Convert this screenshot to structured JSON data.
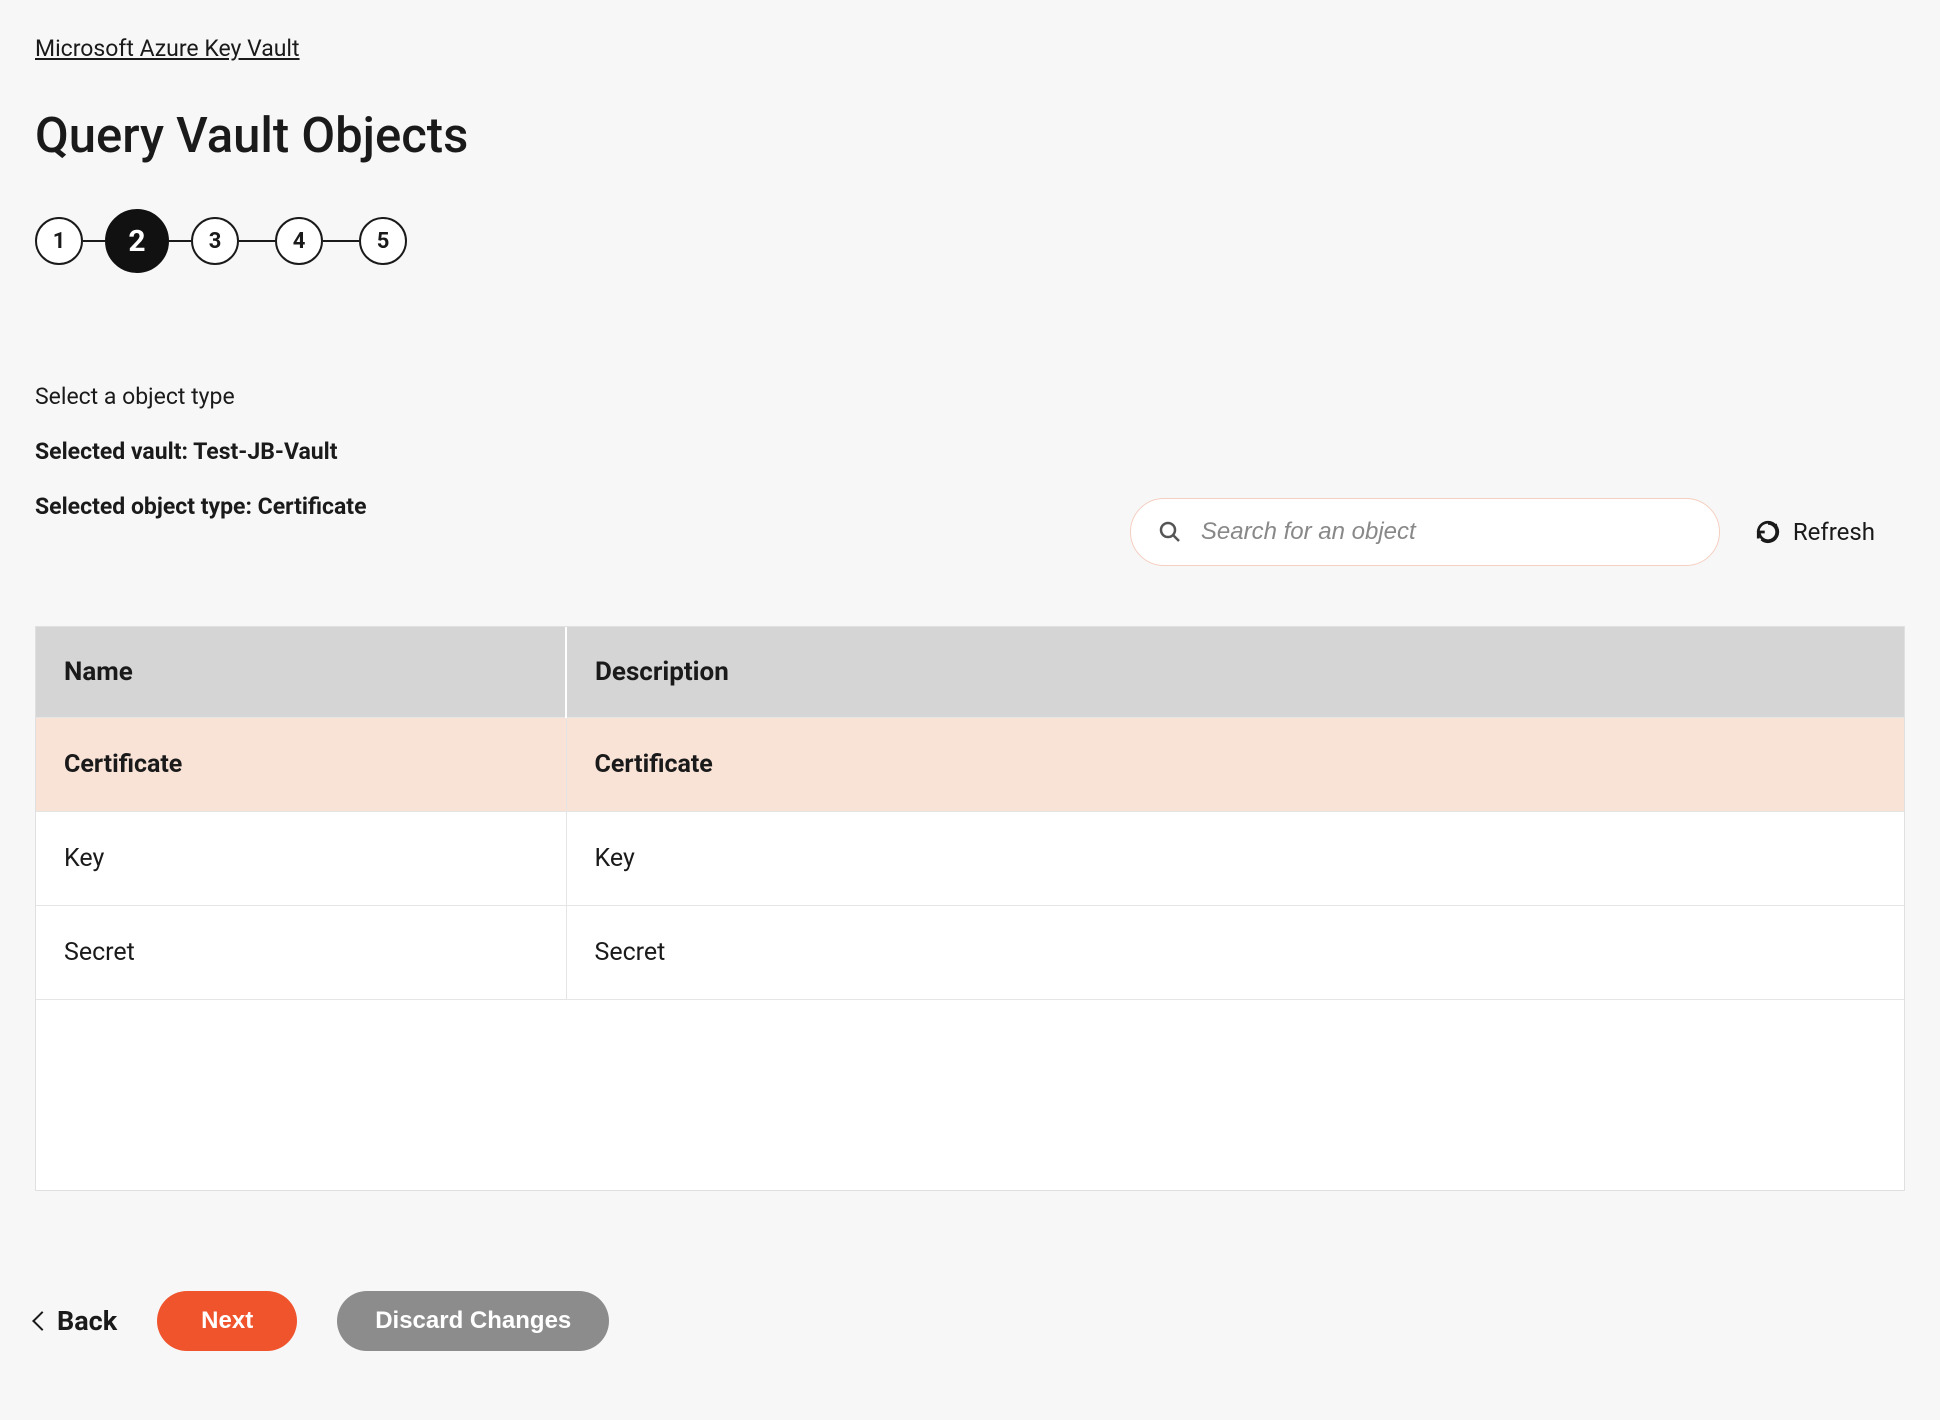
{
  "breadcrumb": {
    "label": "Microsoft Azure Key Vault"
  },
  "page_title": "Query Vault Objects",
  "stepper": {
    "steps": [
      "1",
      "2",
      "3",
      "4",
      "5"
    ],
    "active_index": 1
  },
  "instructions": {
    "select_type": "Select a object type",
    "selected_vault": "Selected vault: Test-JB-Vault",
    "selected_object_type": "Selected object type: Certificate"
  },
  "search": {
    "placeholder": "Search for an object",
    "value": ""
  },
  "refresh_label": "Refresh",
  "table": {
    "headers": {
      "name": "Name",
      "description": "Description"
    },
    "rows": [
      {
        "name": "Certificate",
        "description": "Certificate",
        "selected": true
      },
      {
        "name": "Key",
        "description": "Key",
        "selected": false
      },
      {
        "name": "Secret",
        "description": "Secret",
        "selected": false
      }
    ]
  },
  "buttons": {
    "back": "Back",
    "next": "Next",
    "discard": "Discard Changes"
  }
}
